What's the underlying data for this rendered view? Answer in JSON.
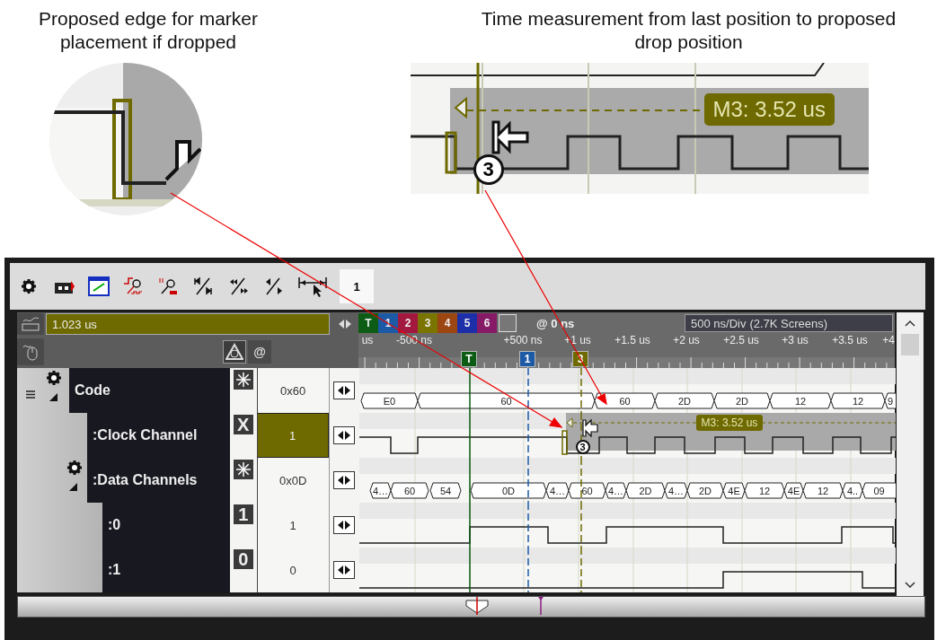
{
  "callouts": [
    {
      "text": "Proposed edge for marker placement if dropped"
    },
    {
      "text": "Time measurement from last position to proposed drop position"
    }
  ],
  "inset": {
    "measurement": "M3: 3.52 us",
    "marker": "3"
  },
  "toolbar": {
    "count": "1"
  },
  "time_field": {
    "value": "1.023 us"
  },
  "at_button": "@",
  "marker_tabs": [
    {
      "label": "T",
      "color": "#0d5c16"
    },
    {
      "label": "1",
      "color": "#1d5aa6"
    },
    {
      "label": "2",
      "color": "#a3183e"
    },
    {
      "label": "3",
      "color": "#7a7400"
    },
    {
      "label": "4",
      "color": "#9c4612"
    },
    {
      "label": "5",
      "color": "#1c2ea8"
    },
    {
      "label": "6",
      "color": "#861a66"
    }
  ],
  "position": "@ 0 ns",
  "scale": {
    "per_div": "500 ns/Div",
    "screens": "(2.7K Screens)"
  },
  "time_ticks": [
    "us",
    "-500 ns",
    "+500 ns",
    "+1 us",
    "+1.5 us",
    "+2 us",
    "+2.5 us",
    "+3 us",
    "+3.5 us",
    "+4"
  ],
  "markers": [
    {
      "label": "T",
      "color": "#0d5c16"
    },
    {
      "label": "1",
      "color": "#1d5aa6"
    },
    {
      "label": "3",
      "color": "#6e6a00"
    }
  ],
  "channels": [
    {
      "name": "Code",
      "kind": "bus",
      "badge": {
        "kind": "star"
      },
      "value": "0x60",
      "selected": false,
      "expanded": true,
      "segments": [
        "E0",
        "60",
        "60",
        "2D",
        "2D",
        "12",
        "12",
        "9"
      ],
      "children": [
        {
          "name": ":Clock Channel",
          "kind": "digital",
          "badge": {
            "kind": "text",
            "label": "X"
          },
          "value": "1",
          "selected": true
        },
        {
          "name": ":Data Channels",
          "kind": "bus",
          "badge": {
            "kind": "star"
          },
          "value": "0x0D",
          "selected": false,
          "expanded": true,
          "segments": [
            "4…",
            "60",
            "54",
            "0D",
            "4…",
            "60",
            "4…",
            "2D",
            "4…",
            "2D",
            "4E",
            "12",
            "4E",
            "12",
            "4..",
            "09"
          ],
          "children": [
            {
              "name": ":0",
              "kind": "digital",
              "badge": {
                "kind": "text",
                "label": "1"
              },
              "value": "1",
              "selected": false
            },
            {
              "name": ":1",
              "kind": "digital",
              "badge": {
                "kind": "text",
                "label": "0"
              },
              "value": "0",
              "selected": false
            }
          ]
        }
      ]
    }
  ],
  "measurement": {
    "label": "M3: 3.52 us",
    "marker": "3"
  }
}
